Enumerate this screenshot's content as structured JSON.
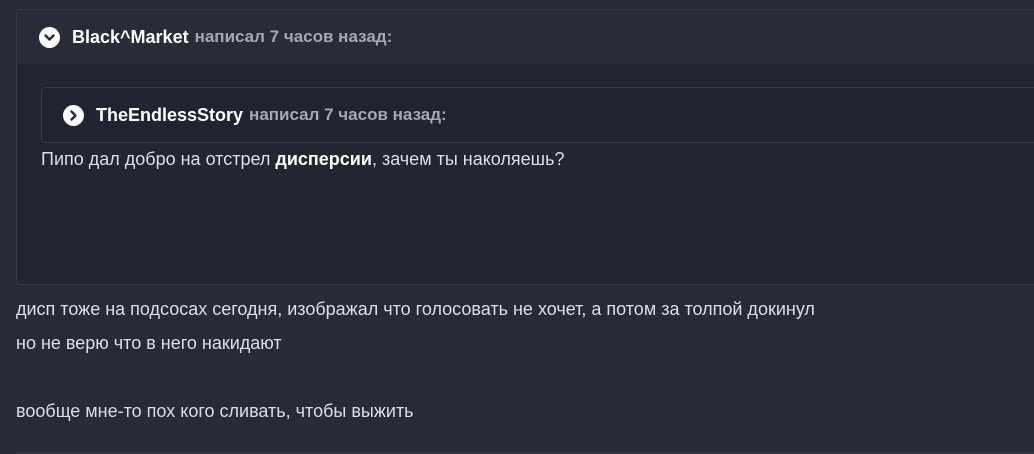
{
  "outer_quote": {
    "author": "Black^Market",
    "wrote": "написал 7 часов назад:",
    "toggle_icon": "chevron-down-icon",
    "inner_quote": {
      "author": "TheEndlessStory",
      "wrote": "написал 7 часов назад:",
      "toggle_icon": "chevron-right-icon"
    },
    "text_before": "Пипо дал добро на отстрел ",
    "text_bold": "дисперсии",
    "text_after": ", зачем ты наколяешь?"
  },
  "body": {
    "line1": "дисп тоже на подсосах сегодня, изображал что голосовать не хочет, а потом за толпой докинул",
    "line2": "но не верю что в него накидают",
    "line3": "вообще мне-то пох кого сливать, чтобы выжить"
  },
  "colors": {
    "background": "#272a37",
    "quote_background": "#232631",
    "quote_header": "#292c38",
    "text": "#dcdfe6",
    "muted": "#a4a8b4"
  }
}
